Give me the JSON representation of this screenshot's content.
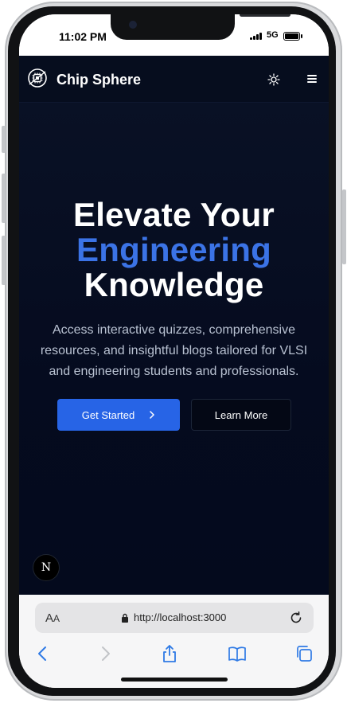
{
  "status_bar": {
    "time": "11:02 PM",
    "network": "5G"
  },
  "navbar": {
    "brand": "Chip Sphere",
    "logo_icon": "chip-logo-icon",
    "theme_icon": "sun-icon",
    "menu_icon": "hamburger-menu-icon"
  },
  "hero": {
    "title_line1": "Elevate Your",
    "title_line2": "Engineering",
    "title_line3": "Knowledge",
    "description": "Access interactive quizzes, comprehensive resources, and insightful blogs tailored for VLSI and engineering students and professionals.",
    "primary_button": "Get Started",
    "secondary_button": "Learn More"
  },
  "next_badge": {
    "letter": "N"
  },
  "browser": {
    "text_size_label": "A",
    "text_size_label_small": "A",
    "url": "http://localhost:3000",
    "toolbar_icons": [
      "back-icon",
      "forward-icon",
      "share-icon",
      "bookmarks-icon",
      "tabs-icon"
    ]
  },
  "colors": {
    "accent": "#3b73e6",
    "primary_button": "#2764e6",
    "background": "#050b1f"
  }
}
